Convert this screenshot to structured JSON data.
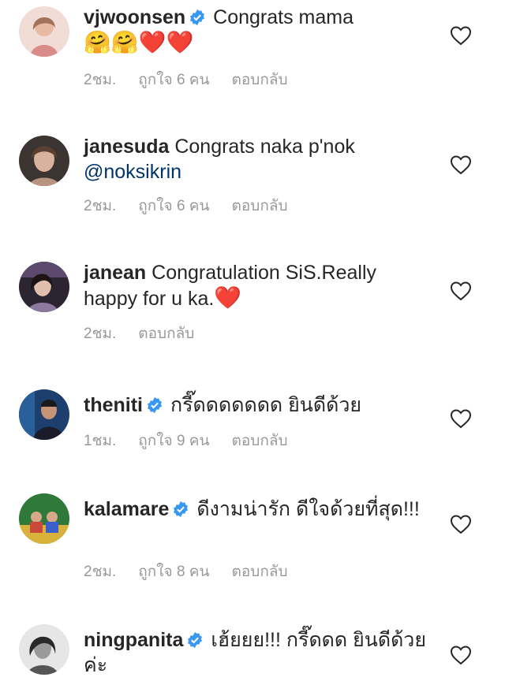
{
  "comments": [
    {
      "username": "vjwoonsen",
      "verified": true,
      "text": "Congrats mama",
      "emojis": "🤗🤗❤️❤️",
      "time": "2ชม.",
      "likes": "ถูกใจ 6 คน",
      "reply": "ตอบกลับ"
    },
    {
      "username": "janesuda",
      "verified": false,
      "text": "Congrats naka p'nok",
      "mention": "@noksikrin",
      "time": "2ชม.",
      "likes": "ถูกใจ 6 คน",
      "reply": "ตอบกลับ"
    },
    {
      "username": "janean",
      "verified": false,
      "text": "Congratulation SiS.Really happy for u ka.",
      "emojis": "❤️",
      "time": "2ชม.",
      "reply": "ตอบกลับ"
    },
    {
      "username": "theniti",
      "verified": true,
      "text": "กรี๊ดดดดดดด ยินดีด้วย",
      "time": "1ชม.",
      "likes": "ถูกใจ 9 คน",
      "reply": "ตอบกลับ"
    },
    {
      "username": "kalamare",
      "verified": true,
      "text": "ดีงามน่ารัก ดีใจด้วยที่สุด!!!",
      "time": "2ชม.",
      "likes": "ถูกใจ 8 คน",
      "reply": "ตอบกลับ"
    },
    {
      "username": "ningpanita",
      "verified": true,
      "text": "เฮ้ยยย!!! กรี๊ดดด ยินดีด้วยค่ะ"
    }
  ],
  "colors": {
    "text": "#262626",
    "meta": "#999999",
    "mention": "#003569",
    "verified": "#3897f0"
  },
  "icons": {
    "like": "heart-outline-icon",
    "verified": "verified-badge-icon"
  }
}
